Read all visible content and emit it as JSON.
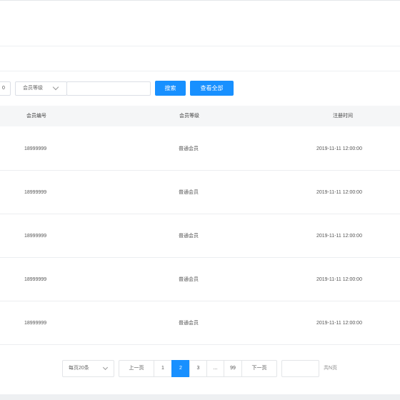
{
  "filters": {
    "prev_value": "0",
    "level_select": "会员等级",
    "text_value": "",
    "search_label": "搜索",
    "view_all_label": "查看全部"
  },
  "table": {
    "headers": [
      "会员编号",
      "会员等级",
      "注册时间"
    ],
    "rows": [
      {
        "id": "18999999",
        "level": "普通会员",
        "registered": "2019-11-11  12:00:00"
      },
      {
        "id": "18999999",
        "level": "普通会员",
        "registered": "2019-11-11  12:00:00"
      },
      {
        "id": "18999999",
        "level": "普通会员",
        "registered": "2019-11-11  12:00:00"
      },
      {
        "id": "18999999",
        "level": "普通会员",
        "registered": "2019-11-11  12:00:00"
      },
      {
        "id": "18999999",
        "level": "普通会员",
        "registered": "2019-11-11  12:00:00"
      }
    ]
  },
  "pagination": {
    "page_size": "每页20条",
    "prev_label": "上一页",
    "pages": [
      "1",
      "2",
      "3",
      "...",
      "99"
    ],
    "current_page": "2",
    "next_label": "下一页",
    "total_label": "共N页"
  },
  "colors": {
    "accent": "#1890ff",
    "header_bg": "#f5f6f7",
    "page_bg": "#eef0f2"
  }
}
